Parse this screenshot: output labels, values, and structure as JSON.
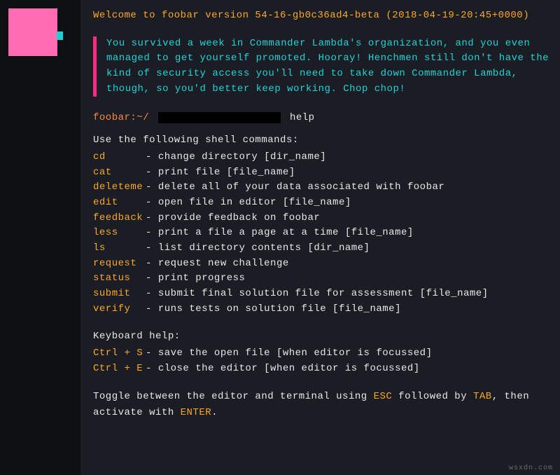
{
  "welcome": "Welcome to foobar version 54-16-gb0c36ad4-beta (2018-04-19-20:45+0000)",
  "quote": "You survived a week in Commander Lambda's organization, and you even managed to get yourself promoted. Hooray! Henchmen still don't have the kind of security access you'll need to take down Commander Lambda, though, so you'd better keep working. Chop chop!",
  "prompt": {
    "host": "foobar:~/",
    "command": "help"
  },
  "help_intro": "Use the following shell commands:",
  "commands": [
    {
      "name": "cd",
      "desc": "change directory [dir_name]"
    },
    {
      "name": "cat",
      "desc": "print file [file_name]"
    },
    {
      "name": "deleteme",
      "desc": "delete all of your data associated with foobar"
    },
    {
      "name": "edit",
      "desc": "open file in editor [file_name]"
    },
    {
      "name": "feedback",
      "desc": "provide feedback on foobar"
    },
    {
      "name": "less",
      "desc": "print a file a page at a time [file_name]"
    },
    {
      "name": "ls",
      "desc": "list directory contents [dir_name]"
    },
    {
      "name": "request",
      "desc": "request new challenge"
    },
    {
      "name": "status",
      "desc": "print progress"
    },
    {
      "name": "submit",
      "desc": "submit final solution file for assessment [file_name]"
    },
    {
      "name": "verify",
      "desc": "runs tests on solution file [file_name]"
    }
  ],
  "keyboard_title": "Keyboard help:",
  "keyboard": [
    {
      "keys": "Ctrl + S",
      "desc": "save the open file [when editor is focussed]"
    },
    {
      "keys": "Ctrl + E",
      "desc": "close the editor [when editor is focussed]"
    }
  ],
  "toggle": {
    "t1": "Toggle between the editor and terminal using ",
    "k1": "ESC",
    "t2": " followed by ",
    "k2": "TAB",
    "t3": ", then activate with ",
    "k3": "ENTER",
    "t4": "."
  },
  "watermark": "wsxdn.com"
}
